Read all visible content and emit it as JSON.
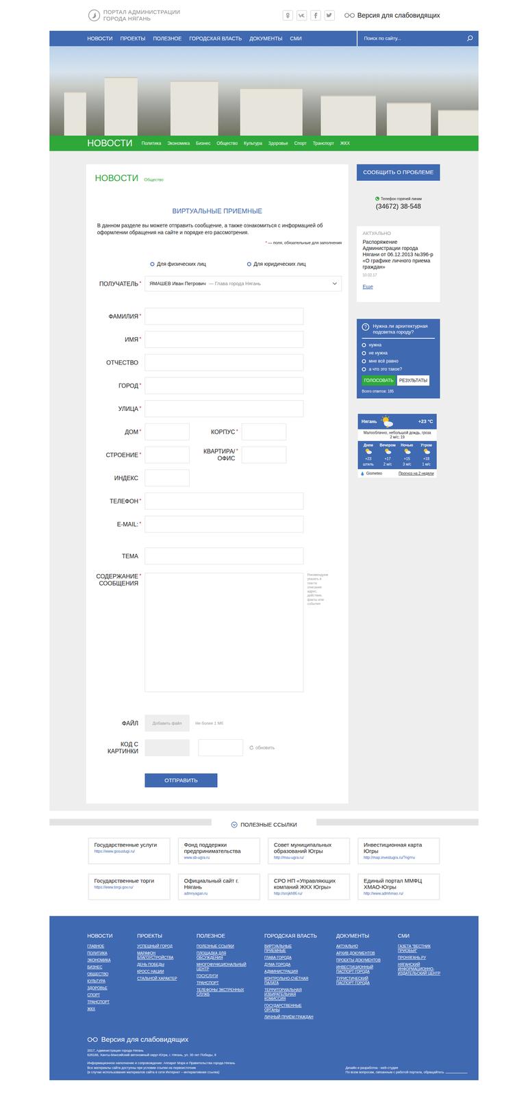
{
  "header": {
    "logo_line1": "ПОРТАЛ АДМИНИСТРАЦИИ",
    "logo_line2": "ГОРОДА НЯГАНЬ",
    "accessibility": "Версия для слабовидящих"
  },
  "nav": {
    "items": [
      "НОВОСТИ",
      "ПРОЕКТЫ",
      "ПОЛЕЗНОЕ",
      "ГОРОДСКАЯ ВЛАСТЬ",
      "ДОКУМЕНТЫ",
      "СМИ"
    ],
    "search": {
      "placeholder": "Поиск по сайту..."
    }
  },
  "section": {
    "title": "НОВОСТИ",
    "tabs": [
      "Политика",
      "Экономика",
      "Бизнес",
      "Общество",
      "Культура",
      "Здоровье",
      "Спорт",
      "Транспорт",
      "ЖКХ"
    ]
  },
  "page": {
    "title": "НОВОСТИ",
    "subtitle": "Общество"
  },
  "form": {
    "title": "ВИРТУАЛЬНЫЕ ПРИЕМНЫЕ",
    "intro": "В данном разделе вы можете отправить сообщение, а также ознакомиться с информацией об оформлении обращения на сайте и порядке его рассмотрения.",
    "required_star": "*",
    "required_note": " — поля, обязательные для заполнения",
    "person_types": [
      {
        "label": "Для физических лиц",
        "selected": false
      },
      {
        "label": "Для юридических лиц",
        "selected": false
      }
    ],
    "recipient": {
      "label": "ПОЛУЧАТЕЛЬ",
      "required": true,
      "name": "ЯМАШЕВ Иван Петрович",
      "role": "— Глава города Нягань"
    },
    "rows": [
      {
        "kind": "wide",
        "fields": [
          {
            "label": "ФАМИЛИЯ",
            "required": true
          }
        ]
      },
      {
        "kind": "wide",
        "fields": [
          {
            "label": "ИМЯ",
            "required": true
          }
        ]
      },
      {
        "kind": "wide",
        "fields": [
          {
            "label": "ОТЧЕСТВО",
            "required": false
          }
        ]
      },
      {
        "kind": "wide",
        "fields": [
          {
            "label": "ГОРОД",
            "required": true
          }
        ]
      },
      {
        "kind": "wide",
        "fields": [
          {
            "label": "УЛИЦА",
            "required": true
          }
        ]
      },
      {
        "kind": "pair",
        "fields": [
          {
            "label": "ДОМ",
            "required": true
          },
          {
            "label": "КОРПУС",
            "required": true
          }
        ]
      },
      {
        "kind": "pair",
        "fields": [
          {
            "label": "СТРОЕНИЕ",
            "required": true
          },
          {
            "label": "КВАРТИРА/ ОФИС",
            "required": true
          }
        ]
      },
      {
        "kind": "short",
        "fields": [
          {
            "label": "ИНДЕКС",
            "required": false
          }
        ]
      },
      {
        "kind": "wide",
        "fields": [
          {
            "label": "ТЕЛЕФОН",
            "required": true
          }
        ]
      },
      {
        "kind": "wide",
        "fields": [
          {
            "label": "E-MAIL:",
            "required": true
          }
        ]
      }
    ],
    "subject": {
      "label": "ТЕМА",
      "required": false
    },
    "body": {
      "label": "СОДЕРЖАНИЕ СООБЩЕНИЯ",
      "required": true,
      "hint": "Рекомендуем указать в тексте описание адрес, действие, факты или события"
    },
    "file": {
      "label": "ФАЙЛ",
      "required": false,
      "button": "Добавить файл",
      "note": "Не более 1 Мб"
    },
    "captcha": {
      "label": "КОД С КАРТИНКИ",
      "required": false,
      "refresh": "обновить"
    },
    "submit": "ОТПРАВИТЬ"
  },
  "sidebar": {
    "report_button": "СООБЩИТЬ О ПРОБЛЕМЕ",
    "hotline": {
      "label": "Телефон горячей линии",
      "phone": "(34672) 38-548"
    },
    "actual": {
      "title": "АКТУАЛЬНО",
      "text": "Распоряжение Администрации города Нягани от 06.12.2013 №396-р «О графике личного приема граждан»",
      "date": "10.02.17",
      "more": "Еще"
    },
    "poll": {
      "icon": "?",
      "question": "Нужна ли архитектурная подсветка городу?",
      "options": [
        {
          "label": "нужна",
          "selected": false
        },
        {
          "label": "не нужна",
          "selected": false
        },
        {
          "label": "мне всё равно",
          "selected": false
        },
        {
          "label": "а что это такое?",
          "selected": false
        }
      ],
      "vote": "ГОЛОСОВАТЬ",
      "results": "РЕЗУЛЬТАТЫ",
      "total": "Всего ответов: 185"
    },
    "weather": {
      "city": "Нягань",
      "temp": "+23 °C",
      "desc": "Малооблачно, небольшой дождь, гроза",
      "wind": "2 м/с; 19",
      "periods": [
        {
          "label": "Днем",
          "temp": "+23",
          "wind": "штиль"
        },
        {
          "label": "Вечером",
          "temp": "+17",
          "wind": "2 м/с"
        },
        {
          "label": "Ночью",
          "temp": "+15",
          "wind": "3 м/с"
        },
        {
          "label": "Утром",
          "temp": "+18",
          "wind": "1 м/с"
        }
      ],
      "source": "Gismeteo",
      "forecast_link": "Прогноз на 2 недели"
    }
  },
  "links": {
    "title": "ПОЛЕЗНЫЕ ССЫЛКИ",
    "items": [
      {
        "title": "Государственные услуги",
        "url": "https://www.gosuslugi.ru/"
      },
      {
        "title": "Фонд поддержки предпринимательства",
        "url": "www.sb-ugra.ru"
      },
      {
        "title": "Совет муниципальных образований Югры",
        "url": "http://msu-ugra.ru/"
      },
      {
        "title": "Инвестиционная карта Югры",
        "url": "http://map.investugra.ru/?ng=ru"
      },
      {
        "title": "Государственные торги",
        "url": "https://www.torgi.gov.ru/"
      },
      {
        "title": "Официальный сайт г. Нягань",
        "url": "admnyagan.ru"
      },
      {
        "title": "СРО НП «Управляющих компаний ЖКХ Югры»",
        "url": "http://srojkh86.ru/"
      },
      {
        "title": "Единый портал ММФЦ ХМАО-Югры",
        "url": "http://www.admhmao.ru/"
      }
    ]
  },
  "footer": {
    "columns": [
      {
        "title": "НОВОСТИ",
        "items": [
          "ГЛАВНОЕ",
          "ПОЛИТИКА",
          "ЭКОНОМИКА",
          "БИЗНЕС",
          "ОБЩЕСТВО",
          "КУЛЬТУРА",
          "ЗДОРОВЬЕ",
          "СПОРТ",
          "ТРАНСПОРТ",
          "ЖКХ"
        ]
      },
      {
        "title": "ПРОЕКТЫ",
        "items": [
          "УСПЕШНЫЙ ГОРОД",
          "МАРАФОН БЛАГОУСТРОЙСТВА",
          "ДЕНЬ ПОБЕДЫ",
          "КРОСС НАЦИИ",
          "СТАЛЬНОЙ ХАРАКТЕР"
        ]
      },
      {
        "title": "ПОЛЕЗНОЕ",
        "items": [
          "ПОЛЕЗНЫЕ ССЫЛКИ",
          "ПЛОЩАДКА ДЛЯ ОБСУЖДЕНИЯ",
          "МНОГОФУНКЦИОНАЛЬНЫЙ ЦЕНТР",
          "ГОСУСЛУГИ",
          "ТРАНСПОРТ",
          "ТЕЛЕФОНЫ ЭКСТРЕННЫХ СЛУЖБ"
        ]
      },
      {
        "title": "ГОРОДСКАЯ ВЛАСТЬ",
        "items": [
          "ВИРТУАЛЬНЫЕ ПРИЕМНЫЕ",
          "ГЛАВА ГОРОДА",
          "ДУМА ГОРОДА",
          "АДМИНИСТРАЦИЯ",
          "КОНТРОЛЬНО-СЧЁТНАЯ ПАЛАТА",
          "ТЕРРИТОРИАЛЬНАЯ ИЗБИРАТЕЛЬНАЯ КОМИССИЯ",
          "ГОСУДАРСТВЕННЫЕ ОРГАНЫ",
          "ЛИЧНЫЙ ПРИЁМ ГРАЖДАН"
        ]
      },
      {
        "title": "ДОКУМЕНТЫ",
        "items": [
          "АКТУАЛЬНО",
          "АРХИВ ДОКУМЕНТОВ",
          "ПРОЕКТЫ ДОКУМЕНТОВ",
          "ИНВЕСТИЦИОННЫЙ ПАСПОРТ ГОРОДА",
          "ТУРИСТИЧЕСКИЙ ПАСПОРТ ГОРОДА"
        ]
      },
      {
        "title": "СМИ",
        "items": [
          "ГАЗЕТА \"ВЕСТНИК ПРИОБЬЯ\"",
          "ПРОНЯГАНЬ.РУ",
          "НЯГАНСКИЙ ИНФОРМАЦИОННО-ИЗДАТЕЛЬСКИЙ ЦЕНТР"
        ]
      }
    ],
    "accessibility": "Версия для слабовидящих",
    "info_top": [
      "2017, Администрация города Нягань",
      "628186, Ханты-Мансийский автономный округ-Югра, г. Нягань, ул. 30 лет Победы, 8"
    ],
    "info_bottom": [
      "Информационное наполнение и сопровождение: Аппарат Мэра и Правительства города Нягань",
      "Все материалы сайта доступны при условии ссылки на первоисточник",
      "(в случае использования материалов сайта в сети Интернет – интерактивная ссылка)"
    ],
    "design": "Дизайн и разработка - web-студия",
    "contact": "По всем вопросам, связанным с работой портала, обращайтесь"
  }
}
